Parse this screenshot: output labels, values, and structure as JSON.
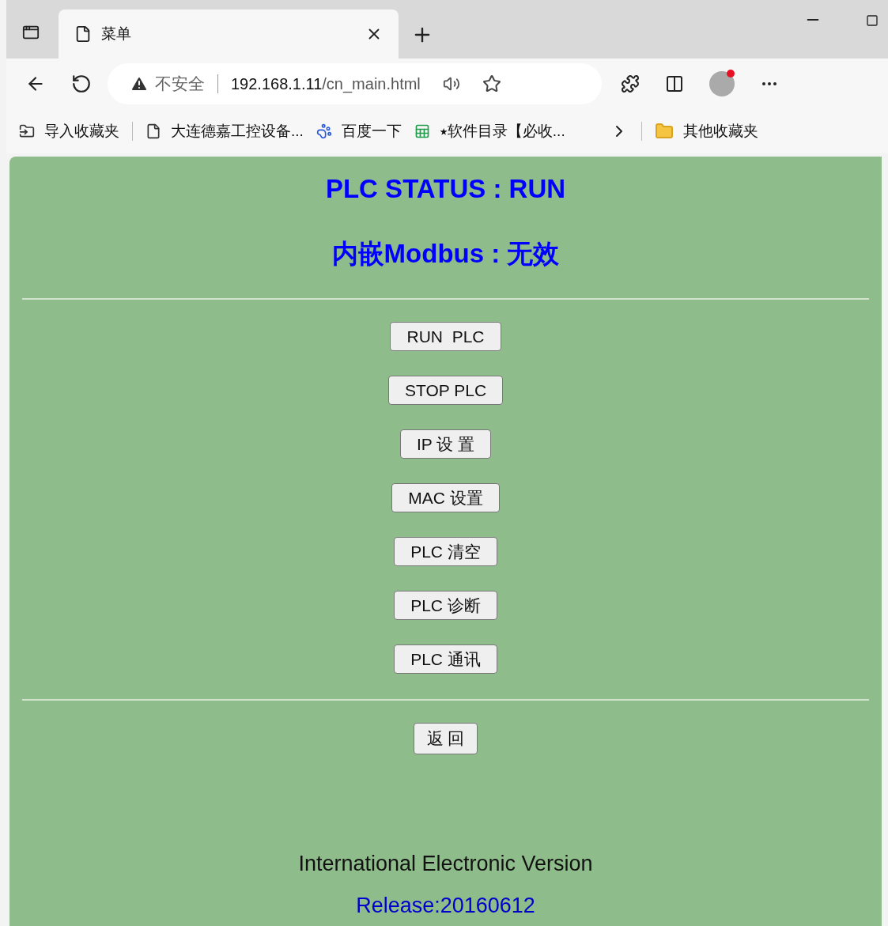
{
  "tab": {
    "title": "菜单",
    "selected": true
  },
  "address": {
    "security": "不安全",
    "host": "192.168.1.11",
    "path": "/cn_main.html"
  },
  "bookmarks": [
    {
      "kind": "import",
      "label": "导入收藏夹"
    },
    {
      "kind": "page",
      "label": "大连德嘉工控设备..."
    },
    {
      "kind": "paw",
      "label": "百度一下"
    },
    {
      "kind": "sheet",
      "label": "⭑软件目录【必收..."
    }
  ],
  "other_bookmarks": "其他收藏夹",
  "page": {
    "status": "PLC STATUS : RUN",
    "modbus": "内嵌Modbus : 无效",
    "buttons": [
      "RUN  PLC",
      "STOP PLC",
      "IP 设 置",
      "MAC 设置",
      "PLC 清空",
      "PLC 诊断",
      "PLC 通讯"
    ],
    "back_button": "返 回",
    "version": "International Electronic Version",
    "release": "Release:20160612"
  }
}
